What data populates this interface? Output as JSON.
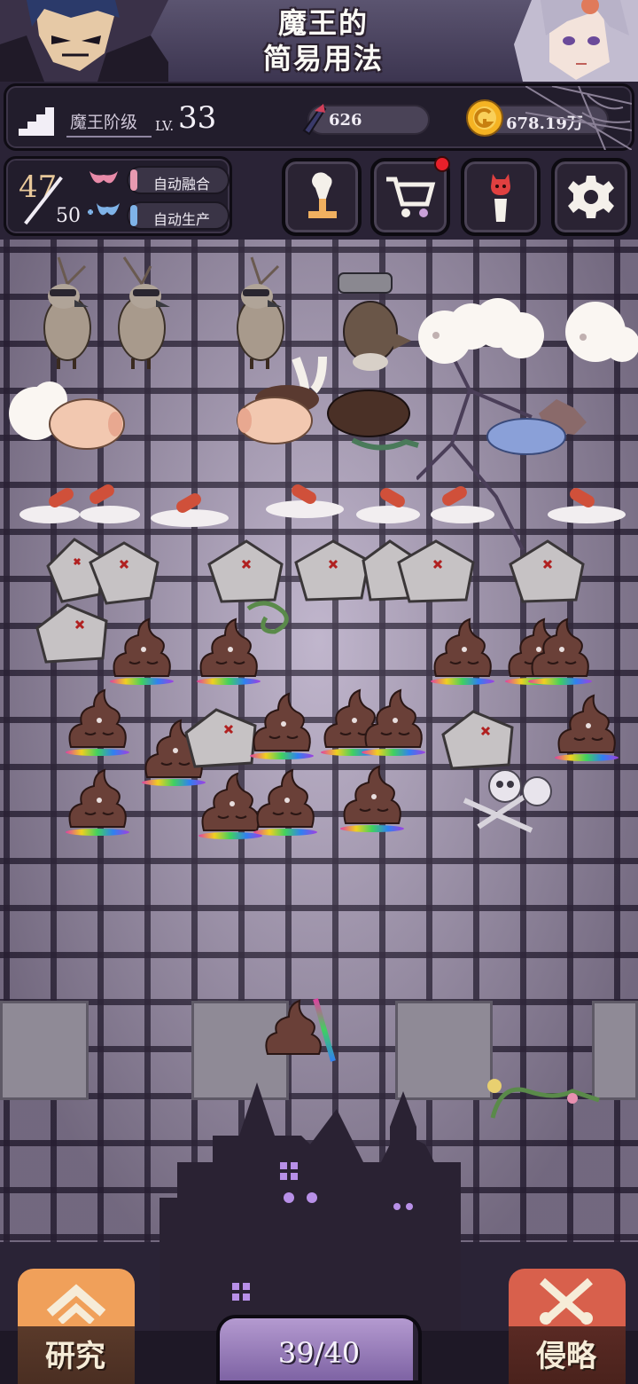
{
  "header": {
    "title_line1": "魔王的",
    "title_line2": "简易用法"
  },
  "status": {
    "rank_label": "魔王阶级",
    "level_prefix": "LV.",
    "level": "33",
    "gems": "626",
    "gold": "678.19万"
  },
  "capacity": {
    "current": "47",
    "max": "50",
    "auto_merge_label": "自动融合",
    "auto_produce_label": "自动生产"
  },
  "actions": {
    "upgrade_icon": "trophy-statue-icon",
    "shop_icon": "cart-icon",
    "demon_icon": "demon-pillar-icon",
    "settings_icon": "gear-icon",
    "shop_has_notification": true
  },
  "bottom": {
    "research_label": "研究",
    "invade_label": "侵略",
    "progress_text": "39/40",
    "progress_value": 0.975
  },
  "colors": {
    "board": "#b8acc6",
    "grid": "#2d2438",
    "research_button": "#f0a05a",
    "invade_button": "#d8604c",
    "notification": "#e8202a"
  }
}
